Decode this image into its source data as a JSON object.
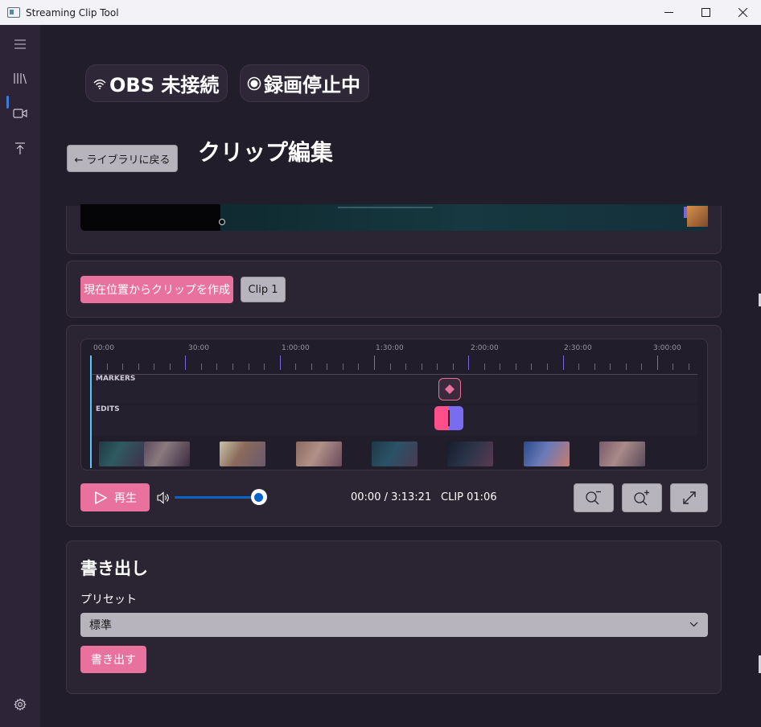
{
  "window": {
    "title": "Streaming Clip Tool"
  },
  "status": {
    "obs": "OBS 未接続",
    "recording": "録画停止中"
  },
  "header": {
    "back_label": "← ライブラリに戻る",
    "title": "クリップ編集"
  },
  "clips": {
    "create_label": "現在位置からクリップを作成",
    "items": [
      "Clip 1"
    ]
  },
  "timeline": {
    "ruler": [
      "00:00",
      "30:00",
      "1:00:00",
      "1:30:00",
      "2:00:00",
      "2:30:00",
      "3:00:00"
    ],
    "rows": {
      "markers": "MARKERS",
      "edits": "EDITS"
    }
  },
  "player": {
    "play_label": "再生",
    "volume_fraction": 0.95,
    "position": "00:00 / 3:13:21",
    "clip_length": "CLIP 01:06"
  },
  "export": {
    "title": "書き出し",
    "preset_label": "プリセット",
    "preset_value": "標準",
    "export_label": "書き出す"
  },
  "colors": {
    "accent": "#e8729d",
    "edit_bar_left": "#ff4f8b",
    "edit_bar_right": "#7a6cf0",
    "ruler_major": "#7a66d8",
    "playhead": "#59c6ff",
    "slider": "#0a64c8"
  }
}
